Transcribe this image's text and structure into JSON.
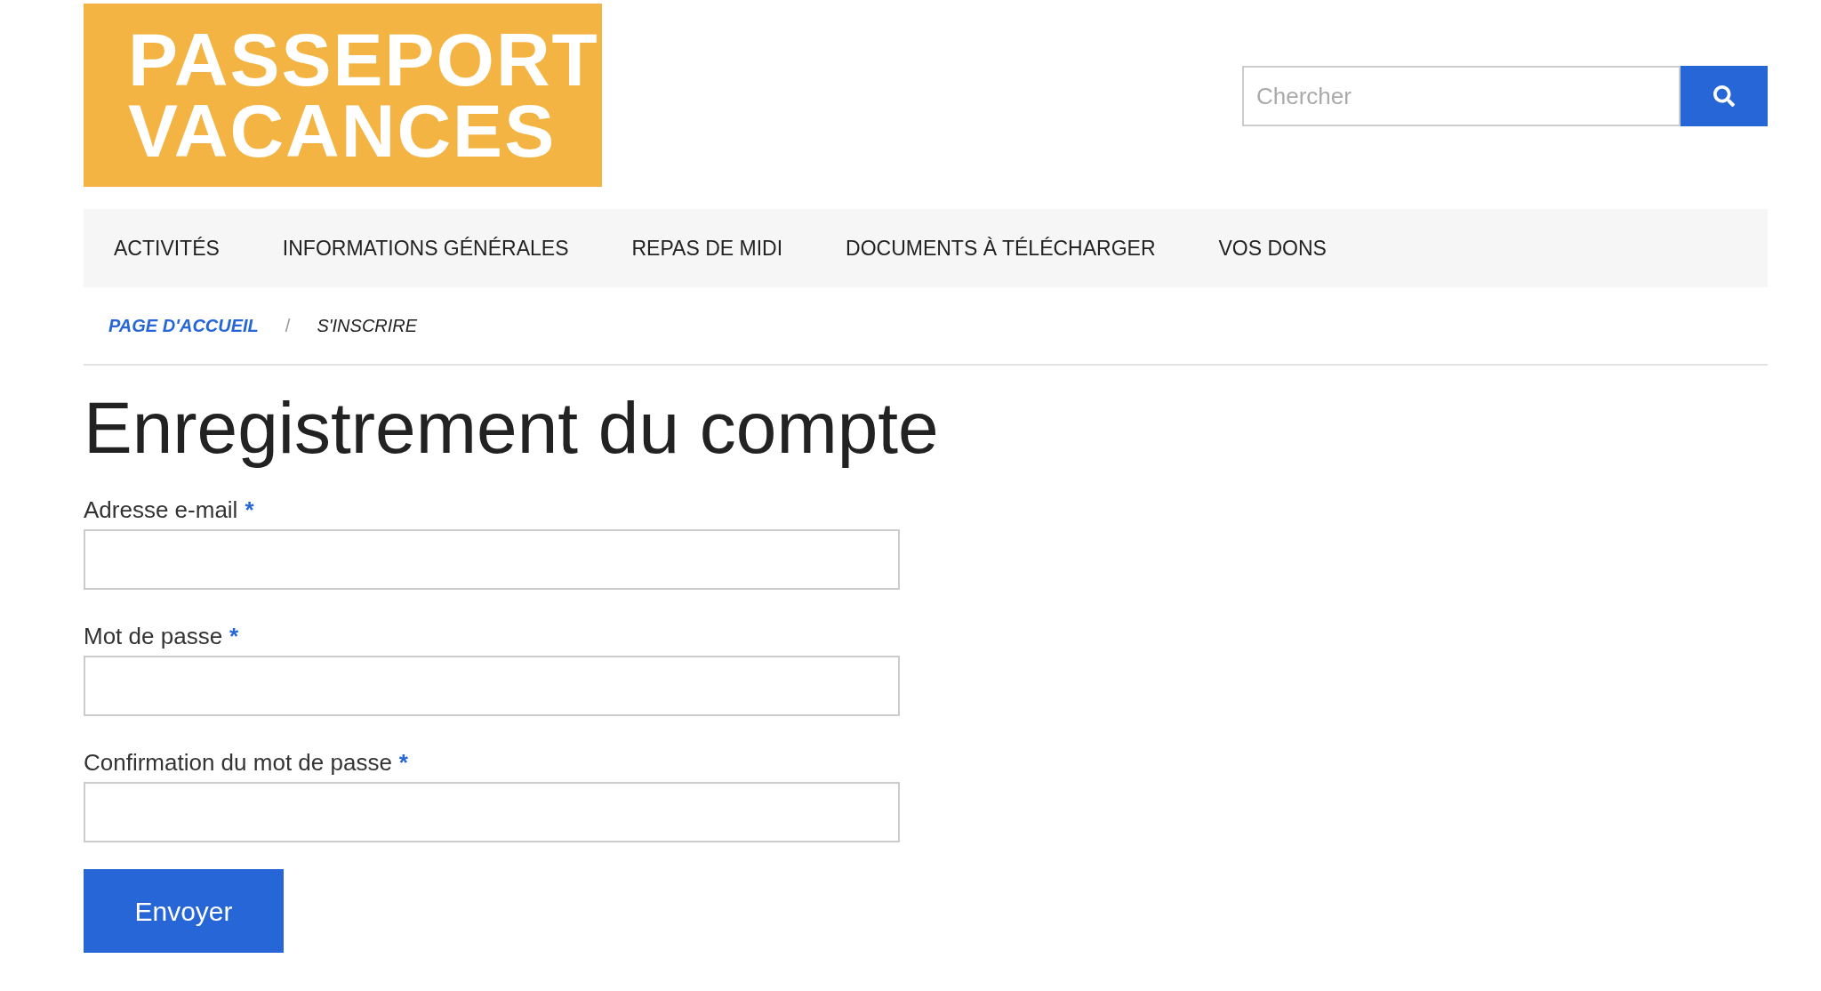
{
  "logo": {
    "lines": [
      "PASSEPORT",
      "VACANCES"
    ]
  },
  "search": {
    "placeholder": "Chercher"
  },
  "nav": [
    {
      "label": "ACTIVITÉS"
    },
    {
      "label": "INFORMATIONS GÉNÉRALES"
    },
    {
      "label": "REPAS DE MIDI"
    },
    {
      "label": "DOCUMENTS À TÉLÉCHARGER"
    },
    {
      "label": "VOS DONS"
    }
  ],
  "breadcrumb": [
    {
      "label": "PAGE D'ACCUEIL",
      "kind": "link"
    },
    {
      "label": "/",
      "kind": "separator"
    },
    {
      "label": "S'INSCRIRE",
      "kind": "current"
    }
  ],
  "title": "Enregistrement du compte",
  "fields": [
    {
      "label": "Adresse e-mail",
      "required_mark": "*"
    },
    {
      "label": "Mot de passe",
      "required_mark": "*"
    },
    {
      "label": "Confirmation du mot de passe",
      "required_mark": "*"
    }
  ],
  "submit": "Envoyer"
}
